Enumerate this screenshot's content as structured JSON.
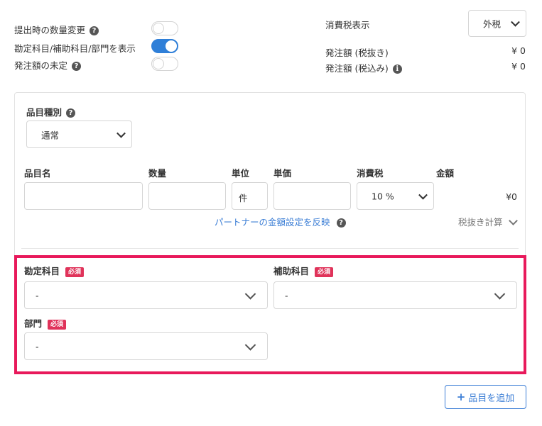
{
  "options": {
    "quantity_change": {
      "label": "提出時の数量変更",
      "on": false
    },
    "show_accounts": {
      "label": "勘定科目/補助科目/部門を表示",
      "on": true
    },
    "amount_undecided": {
      "label": "発注額の未定",
      "on": false
    }
  },
  "tax": {
    "display_label": "消費税表示",
    "display_value": "外税",
    "order_amount_excl_label": "発注額 (税抜き)",
    "order_amount_excl_value": "¥ 0",
    "order_amount_incl_label": "発注額 (税込み)",
    "order_amount_incl_value": "¥ 0"
  },
  "item": {
    "type_label": "品目種別",
    "type_value": "通常",
    "columns": {
      "name": "品目名",
      "quantity": "数量",
      "unit": "単位",
      "unit_price": "単価",
      "tax": "消費税",
      "amount": "金額"
    },
    "unit_value": "件",
    "tax_rate_value": "10 %",
    "amount_value": "¥0",
    "partner_link": "パートナーの金額設定を反映",
    "tax_calc_label": "税抜き計算"
  },
  "accounts": {
    "required_badge": "必須",
    "account_label": "勘定科目",
    "account_value": "-",
    "sub_account_label": "補助科目",
    "sub_account_value": "-",
    "department_label": "部門",
    "department_value": "-"
  },
  "add_item_label": "品目を追加",
  "colors": {
    "accent": "#2f7fd8",
    "highlight": "#e8195b",
    "required": "#e0335a"
  }
}
